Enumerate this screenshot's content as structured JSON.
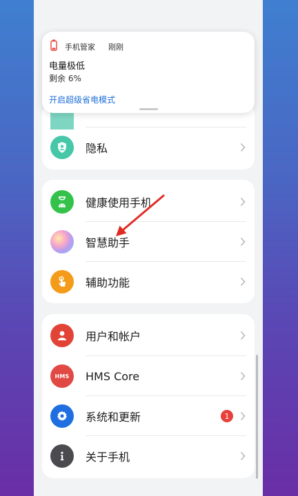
{
  "notification": {
    "app_name": "手机管家",
    "time": "刚刚",
    "title": "电量极低",
    "body": "剩余 6%",
    "action": "开启超级省电模式"
  },
  "groups": [
    {
      "items": [
        {
          "label": "隐私",
          "icon": "privacy-shield-icon",
          "color": "#45c7a8"
        }
      ]
    },
    {
      "items": [
        {
          "label": "健康使用手机",
          "icon": "hourglass-icon",
          "color": "#34c24a"
        },
        {
          "label": "智慧助手",
          "icon": "smart-assistant-orb-icon",
          "color": "#c79bd8"
        },
        {
          "label": "辅助功能",
          "icon": "touch-hand-icon",
          "color": "#f49c1a"
        }
      ]
    },
    {
      "items": [
        {
          "label": "用户和帐户",
          "icon": "user-icon",
          "color": "#e14436"
        },
        {
          "label": "HMS Core",
          "icon": "hms-icon",
          "icon_text": "HMS",
          "color": "#e14a44"
        },
        {
          "label": "系统和更新",
          "icon": "gear-icon",
          "color": "#1f6fe0",
          "badge": "1"
        },
        {
          "label": "关于手机",
          "icon": "info-icon",
          "color": "#4b4b4f"
        }
      ]
    }
  ],
  "colors": {
    "accent": "#1f6ed8",
    "badge": "#e8413b",
    "background": "#f1f3f5"
  }
}
